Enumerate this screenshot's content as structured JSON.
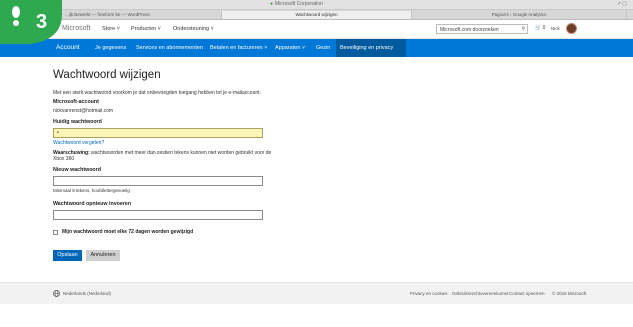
{
  "browser": {
    "address_text": "Microsoft Corporation",
    "tabs": [
      "...ijk Bewerkt — freeform be — WordPress",
      "Wachtwoord wijzigen",
      "Pagina's › Google Analytics"
    ]
  },
  "badge": {
    "number": "3",
    "color": "#2fa84f"
  },
  "header": {
    "logo": "Microsoft",
    "nav": [
      "Store",
      "Producten",
      "Ondersteuning"
    ],
    "search_placeholder": "Microsoft.com doorzoeken",
    "cart_count": "0",
    "user_name": "Nick"
  },
  "account_nav": {
    "items": [
      "Account",
      "Je gegevens",
      "Services en abonnementen",
      "Betalen en factureren",
      "Apparaten",
      "Gezin",
      "Beveiliging en privacy"
    ],
    "accent_color": "#0078d7"
  },
  "form": {
    "title": "Wachtwoord wijzigen",
    "intro": "Met een sterk wachtwoord voorkom je dat onbevoegden toegang hebben tot je e-mailaccount.",
    "account_label": "Microsoft-account",
    "account_email": "nickvanrenst@hotmail.com",
    "current_password_label": "Huidig wachtwoord",
    "current_password_value": "•",
    "forgot_link": "Wachtwoord vergeten?",
    "warning_label": "Waarschuwing:",
    "warning_text": "wachtwoorden met meer dan zestien tekens kunnen niet worden gebruikt voor de Xbox 360",
    "new_password_label": "Nieuw wachtwoord",
    "new_password_hint": "Minimaal 8 tekens, hoofdlettergevoelig",
    "repeat_password_label": "Wachtwoord opnieuw invoeren",
    "expire_checkbox_label": "Mijn wachtwoord moet elke 72 dagen worden gewijzigd",
    "save_button": "Opslaan",
    "cancel_button": "Annuleren"
  },
  "footer": {
    "locale": "Nederlands (Nederland)",
    "links": [
      "Privacy en cookies",
      "Gebruiksrechtovereenkomst",
      "Contact opnemen",
      "© 2015 Microsoft"
    ]
  }
}
